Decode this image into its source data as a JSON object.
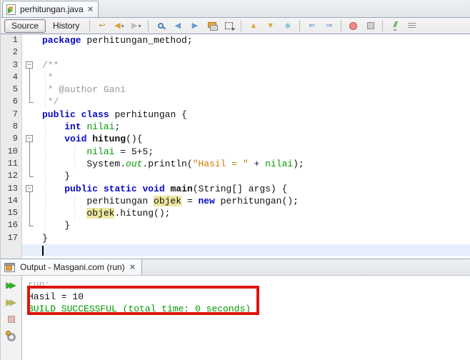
{
  "editor_tab": {
    "title": "perhitungan.java",
    "close_glyph": "×"
  },
  "toolbar": {
    "source_label": "Source",
    "history_label": "History",
    "items": [
      {
        "name": "last-edit-position-icon",
        "kind": "glyph",
        "glyph": "↩",
        "color": "#cc8a2e"
      },
      {
        "name": "back-icon",
        "kind": "glyph",
        "glyph": "◀",
        "color": "#e0a23c",
        "caret": true
      },
      {
        "name": "forward-icon",
        "kind": "glyph",
        "glyph": "▶",
        "color": "#bdbdbd",
        "caret": true
      },
      {
        "name": "sep",
        "kind": "sep"
      },
      {
        "name": "find-icon",
        "kind": "magnifier"
      },
      {
        "name": "previous-occurrence-icon",
        "kind": "glyph",
        "glyph": "◀",
        "color": "#6b9bd2"
      },
      {
        "name": "next-occurrence-icon",
        "kind": "glyph",
        "glyph": "▶",
        "color": "#6b9bd2"
      },
      {
        "name": "toggle-highlight-icon",
        "kind": "highlight"
      },
      {
        "name": "rectangular-selection-icon",
        "kind": "dashed"
      },
      {
        "name": "sep",
        "kind": "sep"
      },
      {
        "name": "previous-bookmark-icon",
        "kind": "glyph",
        "glyph": "▲",
        "color": "#dfa43a"
      },
      {
        "name": "next-bookmark-icon",
        "kind": "glyph",
        "glyph": "▼",
        "color": "#dfa43a"
      },
      {
        "name": "toggle-bookmark-icon",
        "kind": "glyph",
        "glyph": "◆",
        "color": "#8fcbdb"
      },
      {
        "name": "sep",
        "kind": "sep"
      },
      {
        "name": "shift-line-left-icon",
        "kind": "glyph",
        "glyph": "⇐",
        "color": "#5b86c5"
      },
      {
        "name": "shift-line-right-icon",
        "kind": "glyph",
        "glyph": "⇒",
        "color": "#5b86c5"
      },
      {
        "name": "sep",
        "kind": "sep"
      },
      {
        "name": "start-macro-recording-icon",
        "kind": "record"
      },
      {
        "name": "stop-macro-recording-icon",
        "kind": "stopsq"
      },
      {
        "name": "sep",
        "kind": "sep"
      },
      {
        "name": "comment-icon",
        "kind": "comment",
        "glyph": "//"
      },
      {
        "name": "uncomment-icon",
        "kind": "bars"
      }
    ]
  },
  "code": {
    "lines": [
      {
        "n": 1,
        "fold": "",
        "guides": [],
        "tokens": [
          {
            "t": "package",
            "c": "kw"
          },
          {
            "t": " perhitungan_method;",
            "c": "pl"
          }
        ]
      },
      {
        "n": 2,
        "fold": "",
        "guides": [],
        "tokens": []
      },
      {
        "n": 3,
        "fold": "start",
        "guides": [],
        "tokens": [
          {
            "t": "/**",
            "c": "cm"
          }
        ]
      },
      {
        "n": 4,
        "fold": "mid",
        "guides": [
          4
        ],
        "tokens": [
          {
            "t": " *",
            "c": "cm"
          }
        ]
      },
      {
        "n": 5,
        "fold": "mid",
        "guides": [
          4
        ],
        "tokens": [
          {
            "t": " * @author Gani",
            "c": "cm"
          }
        ]
      },
      {
        "n": 6,
        "fold": "end",
        "guides": [
          4
        ],
        "tokens": [
          {
            "t": " */",
            "c": "cm"
          }
        ]
      },
      {
        "n": 7,
        "fold": "",
        "guides": [],
        "tokens": [
          {
            "t": "public",
            "c": "kw"
          },
          {
            "t": " ",
            "c": "pl"
          },
          {
            "t": "class",
            "c": "kw"
          },
          {
            "t": " perhitungan {",
            "c": "pl"
          }
        ]
      },
      {
        "n": 8,
        "fold": "",
        "guides": [
          4
        ],
        "tokens": [
          {
            "t": "    ",
            "c": "pl"
          },
          {
            "t": "int",
            "c": "kw"
          },
          {
            "t": " ",
            "c": "pl"
          },
          {
            "t": "nilai",
            "c": "fld"
          },
          {
            "t": ";",
            "c": "pl"
          }
        ]
      },
      {
        "n": 9,
        "fold": "start",
        "guides": [
          4
        ],
        "tokens": [
          {
            "t": "    ",
            "c": "pl"
          },
          {
            "t": "void",
            "c": "kw"
          },
          {
            "t": " ",
            "c": "pl"
          },
          {
            "t": "hitung",
            "c": "meth"
          },
          {
            "t": "(){",
            "c": "pl"
          }
        ]
      },
      {
        "n": 10,
        "fold": "mid",
        "guides": [
          4,
          45
        ],
        "tokens": [
          {
            "t": "        ",
            "c": "pl"
          },
          {
            "t": "nilai",
            "c": "fld"
          },
          {
            "t": " = 5+5;",
            "c": "pl"
          }
        ]
      },
      {
        "n": 11,
        "fold": "mid",
        "guides": [
          4,
          45
        ],
        "tokens": [
          {
            "t": "        System.",
            "c": "pl"
          },
          {
            "t": "out",
            "c": "out"
          },
          {
            "t": ".println(",
            "c": "pl"
          },
          {
            "t": "\"Hasil = \"",
            "c": "str"
          },
          {
            "t": " + ",
            "c": "pl"
          },
          {
            "t": "nilai",
            "c": "fld"
          },
          {
            "t": ");",
            "c": "pl"
          }
        ]
      },
      {
        "n": 12,
        "fold": "end",
        "guides": [
          4
        ],
        "tokens": [
          {
            "t": "    }",
            "c": "pl"
          }
        ]
      },
      {
        "n": 13,
        "fold": "start",
        "guides": [
          4
        ],
        "tokens": [
          {
            "t": "    ",
            "c": "pl"
          },
          {
            "t": "public",
            "c": "kw"
          },
          {
            "t": " ",
            "c": "pl"
          },
          {
            "t": "static",
            "c": "kw"
          },
          {
            "t": " ",
            "c": "pl"
          },
          {
            "t": "void",
            "c": "kw"
          },
          {
            "t": " ",
            "c": "pl"
          },
          {
            "t": "main",
            "c": "meth"
          },
          {
            "t": "(String[] args) {",
            "c": "pl"
          }
        ]
      },
      {
        "n": 14,
        "fold": "mid",
        "guides": [
          4,
          45
        ],
        "tokens": [
          {
            "t": "        perhitungan ",
            "c": "pl"
          },
          {
            "t": "objek",
            "c": "occ"
          },
          {
            "t": " = ",
            "c": "pl"
          },
          {
            "t": "new",
            "c": "kw"
          },
          {
            "t": " perhitungan();",
            "c": "pl"
          }
        ]
      },
      {
        "n": 15,
        "fold": "mid",
        "guides": [
          4,
          45
        ],
        "tokens": [
          {
            "t": "        ",
            "c": "pl"
          },
          {
            "t": "objek",
            "c": "occ"
          },
          {
            "t": ".hitung();",
            "c": "pl"
          }
        ]
      },
      {
        "n": 16,
        "fold": "end",
        "guides": [
          4
        ],
        "tokens": [
          {
            "t": "    }",
            "c": "pl"
          }
        ]
      },
      {
        "n": 17,
        "fold": "",
        "guides": [],
        "tokens": [
          {
            "t": "}",
            "c": "pl"
          }
        ]
      }
    ],
    "caret_line_after": 17
  },
  "output_panel": {
    "tab_title": "Output - Masgani.com (run)",
    "close_glyph": "×",
    "toolbar": [
      {
        "name": "rerun-button",
        "kind": "arrows2",
        "glyph": "▶▶",
        "color": "#2faf2f"
      },
      {
        "name": "rerun-with-different-parameters-button",
        "kind": "arrows2",
        "glyph": "▶▶",
        "color": "#b4b75a"
      },
      {
        "name": "stop-build-button",
        "kind": "ostop"
      },
      {
        "name": "ant-settings-button",
        "kind": "gear"
      }
    ],
    "lines": [
      {
        "t": "run:",
        "c": "run"
      },
      {
        "t": "Hasil = 10",
        "c": "pl"
      },
      {
        "t": "BUILD SUCCESSFUL (total time: 0 seconds)",
        "c": "ok"
      }
    ]
  },
  "colors": {
    "keyword": "#0a0ac2",
    "comment": "#989898",
    "string": "#ce7b00",
    "field_green": "#009a00",
    "occurrence_highlight": "#efe8a2",
    "caret_line": "#e7eefb",
    "build_success_green": "#009900",
    "annotation_red": "#de150b"
  }
}
